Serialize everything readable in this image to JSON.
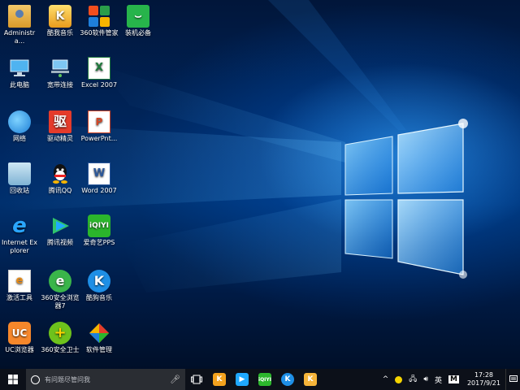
{
  "desktop": {
    "icons": [
      {
        "label": "Administra...",
        "icon": "user-folder-icon"
      },
      {
        "label": "酷我音乐",
        "icon": "kugou-music-icon"
      },
      {
        "label": "360软件管家",
        "icon": "360-software-manager-icon"
      },
      {
        "label": "装机必备",
        "icon": "shopping-bag-icon"
      },
      {
        "label": "此电脑",
        "icon": "this-pc-icon"
      },
      {
        "label": "宽带连接",
        "icon": "broadband-connection-icon"
      },
      {
        "label": "Excel 2007",
        "icon": "excel-icon"
      },
      {
        "label": "网络",
        "icon": "network-icon"
      },
      {
        "label": "驱动精灵",
        "icon": "driver-genius-icon"
      },
      {
        "label": "PowerPnt...",
        "icon": "powerpoint-icon"
      },
      {
        "label": "回收站",
        "icon": "recycle-bin-icon"
      },
      {
        "label": "腾讯QQ",
        "icon": "qq-icon"
      },
      {
        "label": "Word 2007",
        "icon": "word-icon"
      },
      {
        "label": "Internet Explorer",
        "icon": "internet-explorer-icon"
      },
      {
        "label": "腾讯视频",
        "icon": "tencent-video-icon"
      },
      {
        "label": "爱奇艺PPS",
        "icon": "iqiyi-icon"
      },
      {
        "label": "激活工具",
        "icon": "activation-tool-icon"
      },
      {
        "label": "360安全浏览器7",
        "icon": "360-browser-icon"
      },
      {
        "label": "酷狗音乐",
        "icon": "kuwo-music-icon"
      },
      {
        "label": "UC浏览器",
        "icon": "uc-browser-icon"
      },
      {
        "label": "360安全卫士",
        "icon": "360-safeguard-icon"
      },
      {
        "label": "软件管理",
        "icon": "software-management-icon"
      }
    ]
  },
  "taskbar": {
    "search_placeholder": "有问题尽管问我",
    "pinned": [
      "kugou-music-icon",
      "tencent-video-icon",
      "iqiyi-icon",
      "kuwo-music-icon",
      "kugou-box-icon"
    ],
    "tray": {
      "ime_label": "英",
      "ime_mode": "M",
      "time": "17:28",
      "date": "2017/9/21"
    }
  },
  "colors": {
    "taskbar_bg": "#0c1019",
    "search_bg": "#2a2d33",
    "wallpaper_glow": "#3aa8ff"
  }
}
